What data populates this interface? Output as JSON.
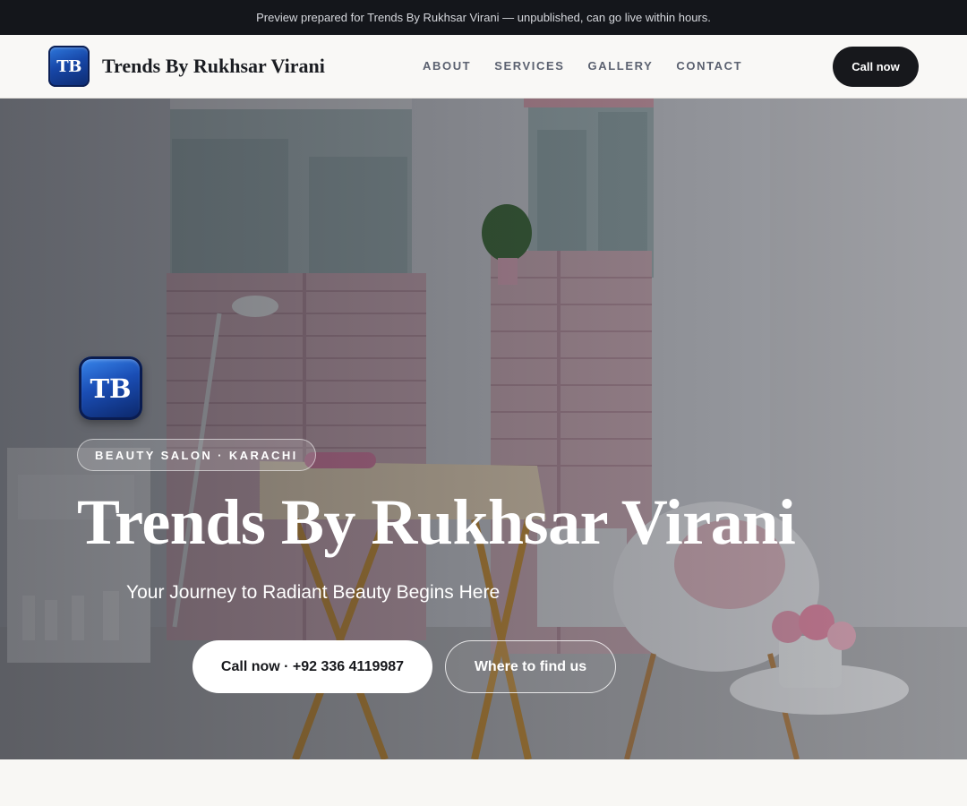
{
  "announcement": "Preview prepared for Trends By Rukhsar Virani — unpublished, can go live within hours.",
  "brand": {
    "logo_text": "TB",
    "name": "Trends By Rukhsar Virani"
  },
  "nav": {
    "links": [
      "ABOUT",
      "SERVICES",
      "GALLERY",
      "CONTACT"
    ],
    "call_label": "Call now"
  },
  "hero": {
    "logo_text": "TB",
    "badge": "BEAUTY SALON · KARACHI",
    "title": "Trends By Rukhsar Virani",
    "subtitle": "Your Journey to Radiant Beauty Begins Here",
    "primary_cta": "Call now · +92 336 4119987",
    "secondary_cta": "Where to find us"
  },
  "colors": {
    "dark": "#14161b",
    "logo_blue": "#1a4db4",
    "accent_pink": "#e8b6c6"
  }
}
